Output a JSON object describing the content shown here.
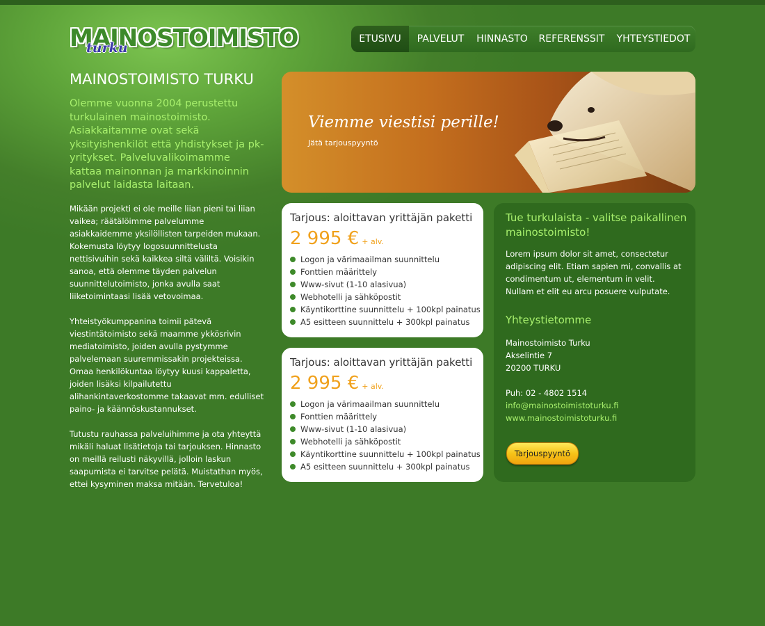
{
  "logo": {
    "main": "MAINOSTOIMISTO",
    "sub": "turku"
  },
  "nav": [
    {
      "label": "ETUSIVU",
      "active": true
    },
    {
      "label": "PALVELUT",
      "active": false
    },
    {
      "label": "HINNASTO",
      "active": false
    },
    {
      "label": "REFERENSSIT",
      "active": false
    },
    {
      "label": "YHTEYSTIEDOT",
      "active": false
    }
  ],
  "left": {
    "title": "MAINOSTOIMISTO TURKU",
    "intro": "Olemme vuonna 2004 perustettu turkulainen mainostoimisto. Asiakkaitamme ovat sekä yksityishenkilöt että yhdistykset ja pk-yritykset. Palveluvalikoimamme kattaa mainonnan ja markkinoinnin palvelut laidasta laitaan.",
    "paragraphs": [
      "Mikään projekti ei ole meille liian pieni tai liian vaikea; räätälöimme palvelumme asiakkaidemme yksilöllisten tarpeiden mukaan. Kokemusta löytyy logosuunnittelusta nettisivuihin sekä kaikkea siltä väliltä. Voisikin sanoa, että olemme täyden palvelun suunnittelutoimisto, jonka avulla saat liiketoimintaasi lisää vetovoimaa.",
      "Yhteistyökumppanina toimii pätevä viestintätoimisto sekä maamme ykkösrivin mediatoimisto, joiden avulla pystymme palvelemaan suuremmissakin projekteissa. Omaa henkilökuntaa löytyy kuusi kappaletta, joiden lisäksi kilpailutettu alihankintaverkostomme takaavat mm. edulliset paino- ja käännöskustannukset.",
      "Tutustu rauhassa palveluihimme ja ota yhteyttä mikäli haluat lisätietoja tai tarjouksen. Hinnasto on meillä reilusti näkyvillä, jolloin laskun saapumista ei tarvitse pelätä. Muistathan myös, ettei kysyminen maksa mitään. Tervetuloa!"
    ]
  },
  "banner": {
    "title": "Viemme viestisi perille!",
    "link": "Jätä tarjouspyyntö"
  },
  "offers": [
    {
      "title": "Tarjous: aloittavan yrittäjän paketti",
      "price": "2 995 €",
      "vat": "+ alv.",
      "items": [
        "Logon ja värimaailman suunnittelu",
        "Fonttien määrittely",
        "Www-sivut (1-10 alasivua)",
        "Webhotelli ja sähköpostit",
        "Käyntikorttine suunnittelu + 100kpl painatus",
        "A5 esitteen suunnittelu + 300kpl painatus"
      ]
    },
    {
      "title": "Tarjous: aloittavan yrittäjän paketti",
      "price": "2 995 €",
      "vat": "+ alv.",
      "items": [
        "Logon ja värimaailman suunnittelu",
        "Fonttien määrittely",
        "Www-sivut (1-10 alasivua)",
        "Webhotelli ja sähköpostit",
        "Käyntikorttine suunnittelu + 100kpl painatus",
        "A5 esitteen suunnittelu + 300kpl painatus"
      ]
    }
  ],
  "right": {
    "title": "Tue turkulaista - valitse paikallinen mainostoimisto!",
    "lorem": "Lorem ipsum dolor sit amet, consectetur adipiscing elit. Etiam sapien mi, convallis at condimentum ut, elementum in velit. Nullam et elit eu arcu posuere vulputate.",
    "contact_heading": "Yhteystietomme",
    "company": "Mainostoimisto Turku",
    "street": "Akselintie 7",
    "postal": "20200 TURKU",
    "phone": "Puh: 02 - 4802 1514",
    "email": "info@mainostoimistoturku.fi",
    "web": "www.mainostoimistoturku.fi",
    "cta": "Tarjouspyyntö"
  },
  "colors": {
    "accent": "#a8f06d",
    "price": "#f0a11c",
    "bg": "#3d7a27",
    "panel": "#2f6a1e"
  }
}
